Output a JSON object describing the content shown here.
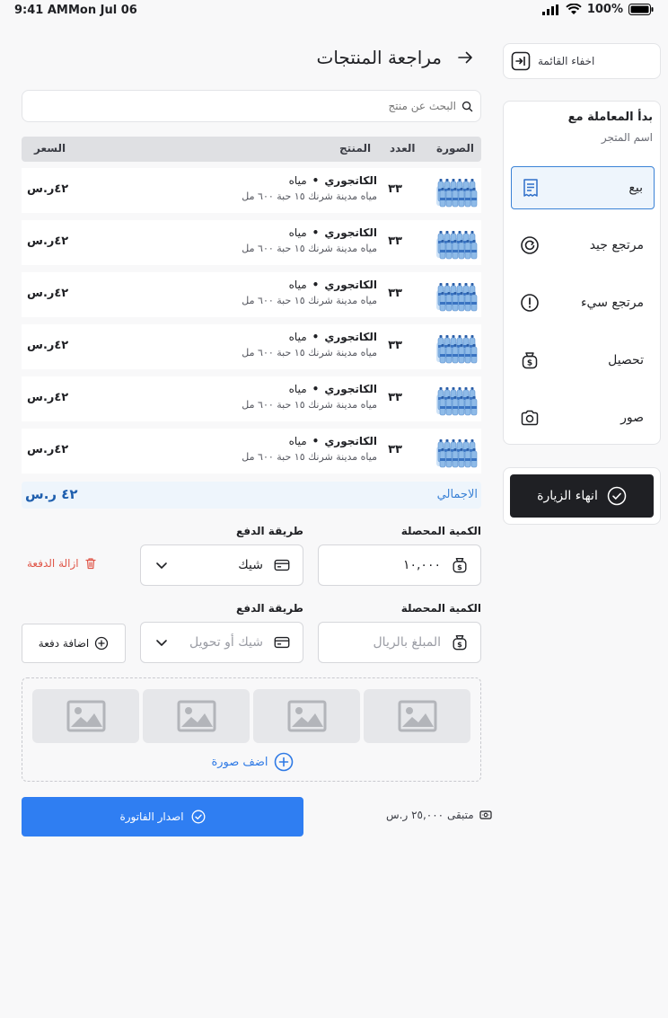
{
  "status_bar": {
    "time": "9:41 AM",
    "date": "Mon Jul 06",
    "battery": "100%"
  },
  "sidebar": {
    "hide_list_label": "اخفاء القائمة",
    "dealing_with_label": "بدأ المعاملة مع",
    "store_name": "اسم المتجر",
    "items": [
      {
        "label": "بيع",
        "icon": "receipt-icon",
        "active": true
      },
      {
        "label": "مرتجع جيد",
        "icon": "refresh-icon",
        "active": false
      },
      {
        "label": "مرتجع سيء",
        "icon": "alert-icon",
        "active": false
      },
      {
        "label": "تحصيل",
        "icon": "money-bag-icon",
        "active": false
      },
      {
        "label": "صور",
        "icon": "camera-icon",
        "active": false
      }
    ],
    "end_visit_label": "انهاء الزيارة"
  },
  "header": {
    "title": "مراجعة المنتجات"
  },
  "search": {
    "placeholder": "البحث عن منتج"
  },
  "table": {
    "columns": {
      "image": "الصورة",
      "qty": "العدد",
      "product": "المنتج",
      "price": "السعر"
    },
    "rows": [
      {
        "category": "الكاتجوري",
        "type": "مياه",
        "description": "مياه مدينة شرنك ١٥ حبة ٦٠٠ مل",
        "qty": "٣٣",
        "price": "٤٢ر.س"
      },
      {
        "category": "الكاتجوري",
        "type": "مياه",
        "description": "مياه مدينة شرنك ١٥ حبة ٦٠٠ مل",
        "qty": "٣٣",
        "price": "٤٢ر.س"
      },
      {
        "category": "الكاتجوري",
        "type": "مياه",
        "description": "مياه مدينة شرنك ١٥ حبة ٦٠٠ مل",
        "qty": "٣٣",
        "price": "٤٢ر.س"
      },
      {
        "category": "الكاتجوري",
        "type": "مياه",
        "description": "مياه مدينة شرنك ١٥ حبة ٦٠٠ مل",
        "qty": "٣٣",
        "price": "٤٢ر.س"
      },
      {
        "category": "الكاتجوري",
        "type": "مياه",
        "description": "مياه مدينة شرنك ١٥ حبة ٦٠٠ مل",
        "qty": "٣٣",
        "price": "٤٢ر.س"
      },
      {
        "category": "الكاتجوري",
        "type": "مياه",
        "description": "مياه مدينة شرنك ١٥ حبة ٦٠٠ مل",
        "qty": "٣٣",
        "price": "٤٢ر.س"
      }
    ],
    "total_label": "الاجمالي",
    "total_value": "٤٢ ر.س"
  },
  "payments": [
    {
      "amount_label": "الكمية المحصلة",
      "amount_value": "١٠,٠٠٠",
      "amount_placeholder": "",
      "method_label": "طريقة الدفع",
      "method_value": "شيك",
      "method_placeholder": ""
    },
    {
      "amount_label": "الكمية المحصلة",
      "amount_value": "",
      "amount_placeholder": "المبلغ بالريال",
      "method_label": "طريقة الدفع",
      "method_value": "",
      "method_placeholder": "شيك أو تحويل"
    }
  ],
  "remove_payment_label": "ازالة الدفعة",
  "add_payment_label": "اضافة دفعة",
  "add_photo_label": "اضف صورة",
  "issue_invoice_label": "اصدار الفاتورة",
  "remaining_label": "متبقى ٢٥,٠٠٠ ر.س",
  "colors": {
    "accent": "#2f7ef2",
    "dark": "#1f2024",
    "danger": "#e0574a"
  }
}
